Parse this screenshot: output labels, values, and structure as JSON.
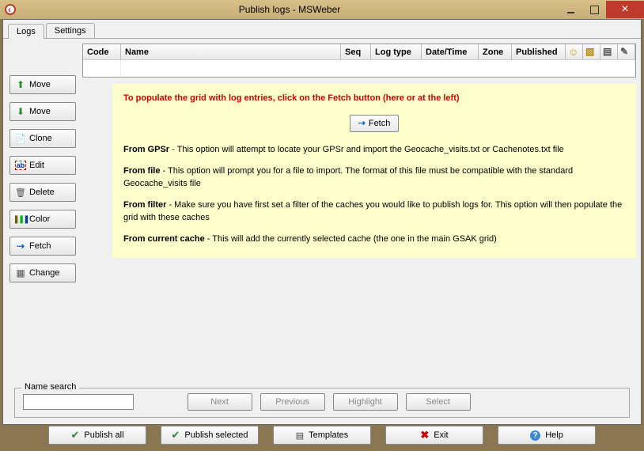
{
  "window": {
    "title": "Publish logs  - MSWeber"
  },
  "tabs": {
    "logs": "Logs",
    "settings": "Settings"
  },
  "sidebar": {
    "move_up": "Move",
    "move_down": "Move",
    "clone": "Clone",
    "edit": "Edit",
    "delete": "Delete",
    "color": "Color",
    "fetch": "Fetch",
    "change": "Change"
  },
  "grid": {
    "headers": {
      "code": "Code",
      "name": "Name",
      "seq": "Seq",
      "logtype": "Log type",
      "datetime": "Date/Time",
      "zone": "Zone",
      "published": "Published"
    },
    "icon_headers": {
      "smiley": "smiley-icon",
      "image": "image-icon",
      "notes": "notes-icon",
      "edit": "edit-icon"
    }
  },
  "info": {
    "title": "To populate the grid with log entries, click on the Fetch button (here or at the left)",
    "fetch_button": "Fetch",
    "p1_b": "From GPSr",
    "p1": " - This option will attempt to locate your GPSr and import the Geocache_visits.txt or Cachenotes.txt file",
    "p2_b": "From file",
    "p2": " - This option will prompt you for a file to import. The format of this file must be compatible with the standard Geocache_visits file",
    "p3_b": "From filter",
    "p3": " - Make sure you have first set a filter of the caches you would like to publish logs for. This option will then populate the grid with these caches",
    "p4_b": "From current cache",
    "p4": " - This will add the currently selected cache (the one in the main GSAK grid)"
  },
  "search": {
    "legend": "Name search",
    "value": "",
    "next": "Next",
    "previous": "Previous",
    "highlight": "Highlight",
    "select": "Select"
  },
  "bottom": {
    "publish_all": "Publish all",
    "publish_selected": "Publish selected",
    "templates": "Templates",
    "exit": "Exit",
    "help": "Help"
  }
}
